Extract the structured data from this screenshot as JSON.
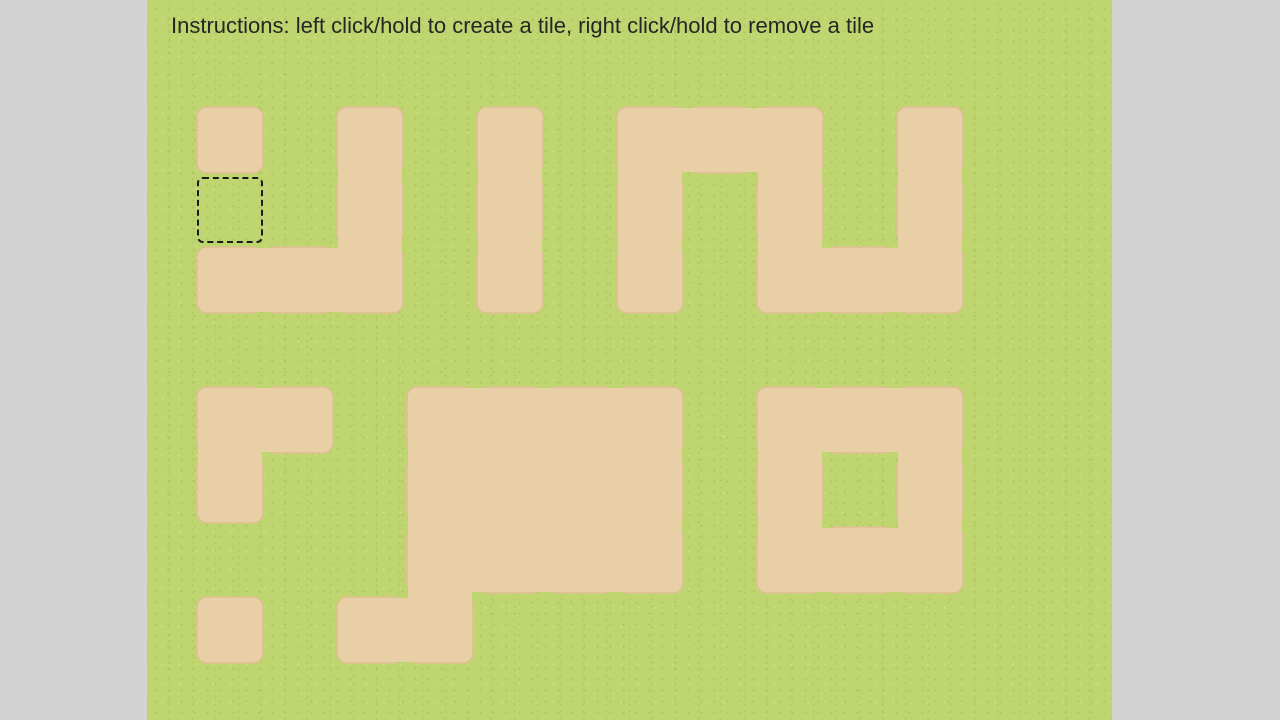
{
  "instructions": "Instructions: left click/hold to create a tile, right click/hold to remove a tile",
  "colors": {
    "page_background": "#d3d3d3",
    "grass": "#bfd56f",
    "sand_tile": "#e8cfa6",
    "sand_tile_edge": "#ddbf92",
    "cursor_outline": "#1a1a1a"
  },
  "board": {
    "columns": 12,
    "rows": 8,
    "sand_cells": [
      [
        0,
        0
      ],
      [
        2,
        0
      ],
      [
        4,
        0
      ],
      [
        6,
        0
      ],
      [
        7,
        0
      ],
      [
        8,
        0
      ],
      [
        10,
        0
      ],
      [
        2,
        1
      ],
      [
        4,
        1
      ],
      [
        6,
        1
      ],
      [
        8,
        1
      ],
      [
        10,
        1
      ],
      [
        0,
        2
      ],
      [
        1,
        2
      ],
      [
        2,
        2
      ],
      [
        4,
        2
      ],
      [
        6,
        2
      ],
      [
        8,
        2
      ],
      [
        9,
        2
      ],
      [
        10,
        2
      ],
      [
        0,
        4
      ],
      [
        1,
        4
      ],
      [
        3,
        4
      ],
      [
        4,
        4
      ],
      [
        5,
        4
      ],
      [
        6,
        4
      ],
      [
        8,
        4
      ],
      [
        9,
        4
      ],
      [
        10,
        4
      ],
      [
        0,
        5
      ],
      [
        3,
        5
      ],
      [
        4,
        5
      ],
      [
        5,
        5
      ],
      [
        6,
        5
      ],
      [
        8,
        5
      ],
      [
        10,
        5
      ],
      [
        3,
        6
      ],
      [
        4,
        6
      ],
      [
        5,
        6
      ],
      [
        6,
        6
      ],
      [
        8,
        6
      ],
      [
        9,
        6
      ],
      [
        10,
        6
      ],
      [
        0,
        7
      ],
      [
        2,
        7
      ],
      [
        3,
        7
      ]
    ],
    "cursor_cell": [
      0,
      1
    ]
  }
}
